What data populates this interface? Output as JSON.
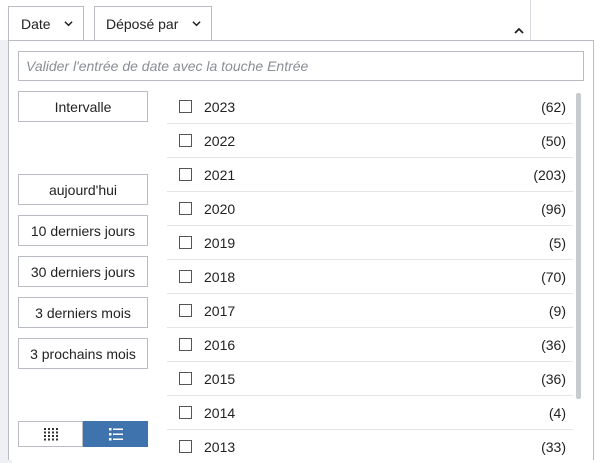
{
  "filters": {
    "date_label": "Date",
    "depose_label": "Déposé par"
  },
  "panel": {
    "date_input_placeholder": "Valider l'entrée de date avec la touche Entrée",
    "interval_label": "Intervalle",
    "quick_ranges": [
      "aujourd'hui",
      "10 derniers jours",
      "30 derniers jours",
      "3 derniers mois",
      "3 prochains mois"
    ],
    "years": [
      {
        "year": "2023",
        "count": "(62)"
      },
      {
        "year": "2022",
        "count": "(50)"
      },
      {
        "year": "2021",
        "count": "(203)"
      },
      {
        "year": "2020",
        "count": "(96)"
      },
      {
        "year": "2019",
        "count": "(5)"
      },
      {
        "year": "2018",
        "count": "(70)"
      },
      {
        "year": "2017",
        "count": "(9)"
      },
      {
        "year": "2016",
        "count": "(36)"
      },
      {
        "year": "2015",
        "count": "(36)"
      },
      {
        "year": "2014",
        "count": "(4)"
      },
      {
        "year": "2013",
        "count": "(33)"
      }
    ],
    "view_modes": {
      "grid_icon": "grid-icon",
      "list_icon": "list-icon",
      "active": "list"
    }
  },
  "colors": {
    "accent": "#3f73ad",
    "border": "#b9bdc3"
  }
}
